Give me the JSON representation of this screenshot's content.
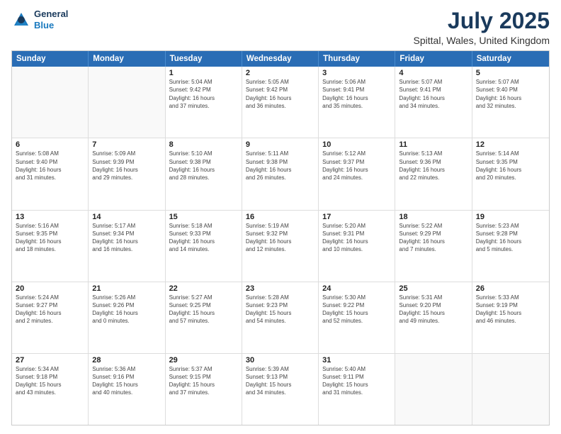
{
  "header": {
    "logo": {
      "general": "General",
      "blue": "Blue"
    },
    "title": "July 2025",
    "subtitle": "Spittal, Wales, United Kingdom"
  },
  "calendar": {
    "days_of_week": [
      "Sunday",
      "Monday",
      "Tuesday",
      "Wednesday",
      "Thursday",
      "Friday",
      "Saturday"
    ],
    "weeks": [
      [
        {
          "day": "",
          "info": ""
        },
        {
          "day": "",
          "info": ""
        },
        {
          "day": "1",
          "info": "Sunrise: 5:04 AM\nSunset: 9:42 PM\nDaylight: 16 hours\nand 37 minutes."
        },
        {
          "day": "2",
          "info": "Sunrise: 5:05 AM\nSunset: 9:42 PM\nDaylight: 16 hours\nand 36 minutes."
        },
        {
          "day": "3",
          "info": "Sunrise: 5:06 AM\nSunset: 9:41 PM\nDaylight: 16 hours\nand 35 minutes."
        },
        {
          "day": "4",
          "info": "Sunrise: 5:07 AM\nSunset: 9:41 PM\nDaylight: 16 hours\nand 34 minutes."
        },
        {
          "day": "5",
          "info": "Sunrise: 5:07 AM\nSunset: 9:40 PM\nDaylight: 16 hours\nand 32 minutes."
        }
      ],
      [
        {
          "day": "6",
          "info": "Sunrise: 5:08 AM\nSunset: 9:40 PM\nDaylight: 16 hours\nand 31 minutes."
        },
        {
          "day": "7",
          "info": "Sunrise: 5:09 AM\nSunset: 9:39 PM\nDaylight: 16 hours\nand 29 minutes."
        },
        {
          "day": "8",
          "info": "Sunrise: 5:10 AM\nSunset: 9:38 PM\nDaylight: 16 hours\nand 28 minutes."
        },
        {
          "day": "9",
          "info": "Sunrise: 5:11 AM\nSunset: 9:38 PM\nDaylight: 16 hours\nand 26 minutes."
        },
        {
          "day": "10",
          "info": "Sunrise: 5:12 AM\nSunset: 9:37 PM\nDaylight: 16 hours\nand 24 minutes."
        },
        {
          "day": "11",
          "info": "Sunrise: 5:13 AM\nSunset: 9:36 PM\nDaylight: 16 hours\nand 22 minutes."
        },
        {
          "day": "12",
          "info": "Sunrise: 5:14 AM\nSunset: 9:35 PM\nDaylight: 16 hours\nand 20 minutes."
        }
      ],
      [
        {
          "day": "13",
          "info": "Sunrise: 5:16 AM\nSunset: 9:35 PM\nDaylight: 16 hours\nand 18 minutes."
        },
        {
          "day": "14",
          "info": "Sunrise: 5:17 AM\nSunset: 9:34 PM\nDaylight: 16 hours\nand 16 minutes."
        },
        {
          "day": "15",
          "info": "Sunrise: 5:18 AM\nSunset: 9:33 PM\nDaylight: 16 hours\nand 14 minutes."
        },
        {
          "day": "16",
          "info": "Sunrise: 5:19 AM\nSunset: 9:32 PM\nDaylight: 16 hours\nand 12 minutes."
        },
        {
          "day": "17",
          "info": "Sunrise: 5:20 AM\nSunset: 9:31 PM\nDaylight: 16 hours\nand 10 minutes."
        },
        {
          "day": "18",
          "info": "Sunrise: 5:22 AM\nSunset: 9:29 PM\nDaylight: 16 hours\nand 7 minutes."
        },
        {
          "day": "19",
          "info": "Sunrise: 5:23 AM\nSunset: 9:28 PM\nDaylight: 16 hours\nand 5 minutes."
        }
      ],
      [
        {
          "day": "20",
          "info": "Sunrise: 5:24 AM\nSunset: 9:27 PM\nDaylight: 16 hours\nand 2 minutes."
        },
        {
          "day": "21",
          "info": "Sunrise: 5:26 AM\nSunset: 9:26 PM\nDaylight: 16 hours\nand 0 minutes."
        },
        {
          "day": "22",
          "info": "Sunrise: 5:27 AM\nSunset: 9:25 PM\nDaylight: 15 hours\nand 57 minutes."
        },
        {
          "day": "23",
          "info": "Sunrise: 5:28 AM\nSunset: 9:23 PM\nDaylight: 15 hours\nand 54 minutes."
        },
        {
          "day": "24",
          "info": "Sunrise: 5:30 AM\nSunset: 9:22 PM\nDaylight: 15 hours\nand 52 minutes."
        },
        {
          "day": "25",
          "info": "Sunrise: 5:31 AM\nSunset: 9:20 PM\nDaylight: 15 hours\nand 49 minutes."
        },
        {
          "day": "26",
          "info": "Sunrise: 5:33 AM\nSunset: 9:19 PM\nDaylight: 15 hours\nand 46 minutes."
        }
      ],
      [
        {
          "day": "27",
          "info": "Sunrise: 5:34 AM\nSunset: 9:18 PM\nDaylight: 15 hours\nand 43 minutes."
        },
        {
          "day": "28",
          "info": "Sunrise: 5:36 AM\nSunset: 9:16 PM\nDaylight: 15 hours\nand 40 minutes."
        },
        {
          "day": "29",
          "info": "Sunrise: 5:37 AM\nSunset: 9:15 PM\nDaylight: 15 hours\nand 37 minutes."
        },
        {
          "day": "30",
          "info": "Sunrise: 5:39 AM\nSunset: 9:13 PM\nDaylight: 15 hours\nand 34 minutes."
        },
        {
          "day": "31",
          "info": "Sunrise: 5:40 AM\nSunset: 9:11 PM\nDaylight: 15 hours\nand 31 minutes."
        },
        {
          "day": "",
          "info": ""
        },
        {
          "day": "",
          "info": ""
        }
      ]
    ]
  }
}
